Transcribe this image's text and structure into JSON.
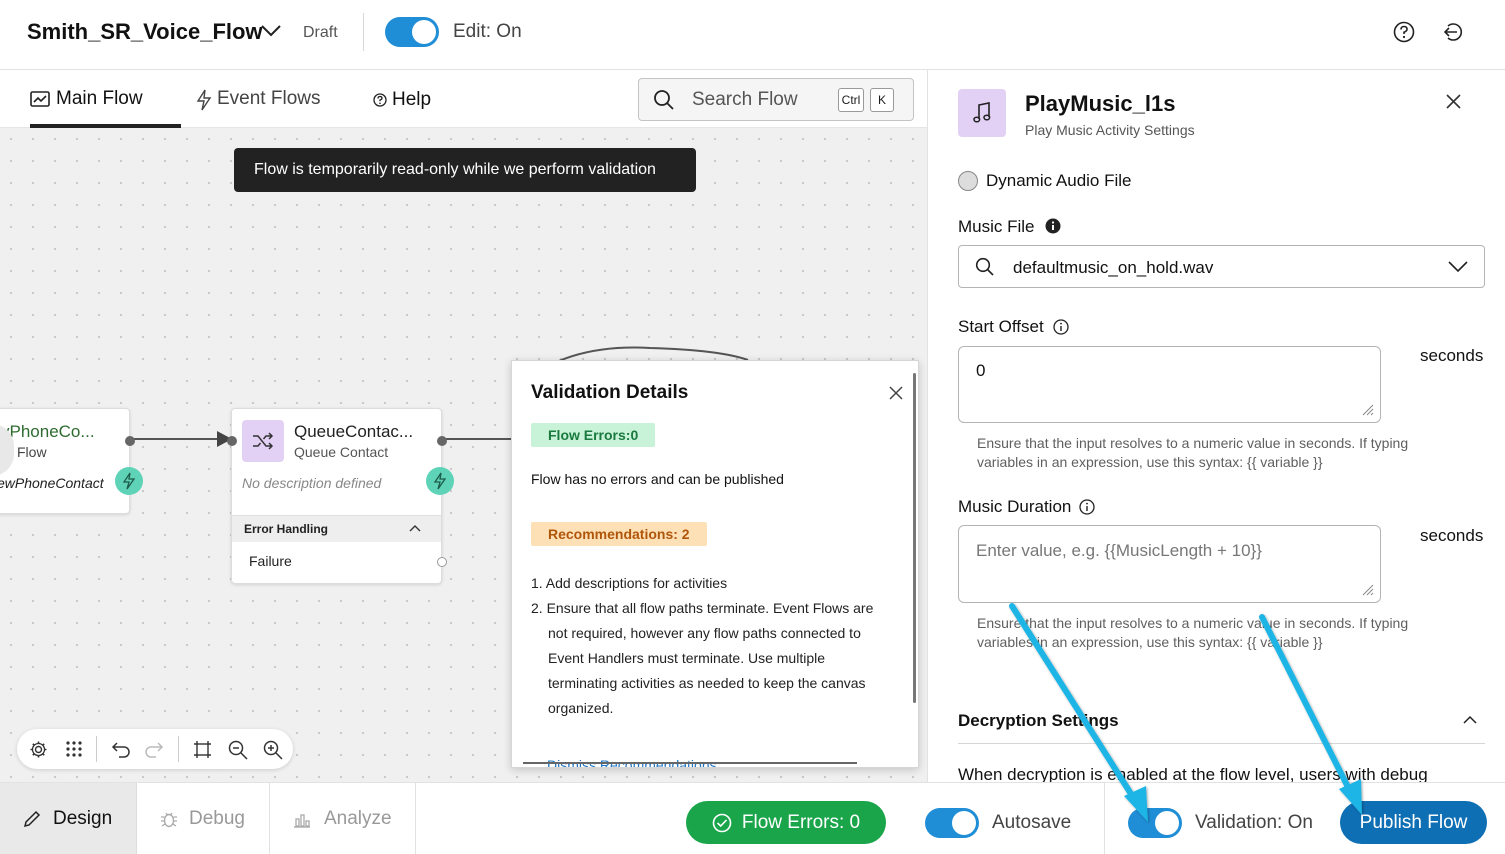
{
  "header": {
    "flow_name": "Smith_SR_Voice_Flow",
    "status": "Draft",
    "edit_label": "Edit: On"
  },
  "tabs": {
    "main_flow": "Main Flow",
    "event_flows": "Event Flows",
    "help": "Help"
  },
  "search": {
    "placeholder": "Search Flow",
    "shortcut_key1": "Ctrl",
    "shortcut_key2": "K"
  },
  "toast": {
    "message": "Flow is temporarily read-only while we perform validation"
  },
  "nodes": {
    "node1": {
      "title": "vPhoneCo...",
      "back_label": "Flow",
      "description": "ewPhoneContact"
    },
    "node2": {
      "title": "QueueContac...",
      "subtitle": "Queue Contact",
      "description": "No description defined",
      "error_handling_label": "Error Handling",
      "failure_label": "Failure"
    }
  },
  "validation": {
    "title": "Validation Details",
    "errors_badge": "Flow Errors:0",
    "no_errors_message": "Flow has no errors and can be published",
    "recommendations_badge": "Recommendations: 2",
    "recommendations": [
      "1. Add descriptions for activities",
      "2. Ensure that all flow paths terminate. Event Flows are not required, however any flow paths connected to Event Handlers must terminate. Use multiple terminating activities as needed to keep the canvas organized."
    ],
    "cut_link": "Dismiss Recommendations"
  },
  "panel": {
    "title": "PlayMusic_l1s",
    "subtitle": "Play Music Activity Settings",
    "dynamic_audio_label": "Dynamic Audio File",
    "music_file_label": "Music File",
    "music_file_value": "defaultmusic_on_hold.wav",
    "start_offset_label": "Start Offset",
    "start_offset_value": "0",
    "seconds_label": "seconds",
    "helper_text": "Ensure that the input resolves to a numeric value in seconds. If typing variables in an expression, use this syntax: {{ variable }}",
    "music_duration_label": "Music Duration",
    "music_duration_placeholder": "Enter value, e.g. {{MusicLength + 10}}",
    "decryption_label": "Decryption Settings",
    "decryption_text": "When decryption is enabled at the flow level, users with debug"
  },
  "footer": {
    "design": "Design",
    "debug": "Debug",
    "analyze": "Analyze",
    "flow_errors": "Flow Errors: 0",
    "autosave": "Autosave",
    "validation": "Validation: On",
    "publish": "Publish Flow"
  },
  "colors": {
    "accent_blue": "#1f8ed6",
    "success_green": "#1aa54b",
    "publish_blue": "#0f6fb4",
    "annotation_arrow": "#1fb5e6"
  }
}
